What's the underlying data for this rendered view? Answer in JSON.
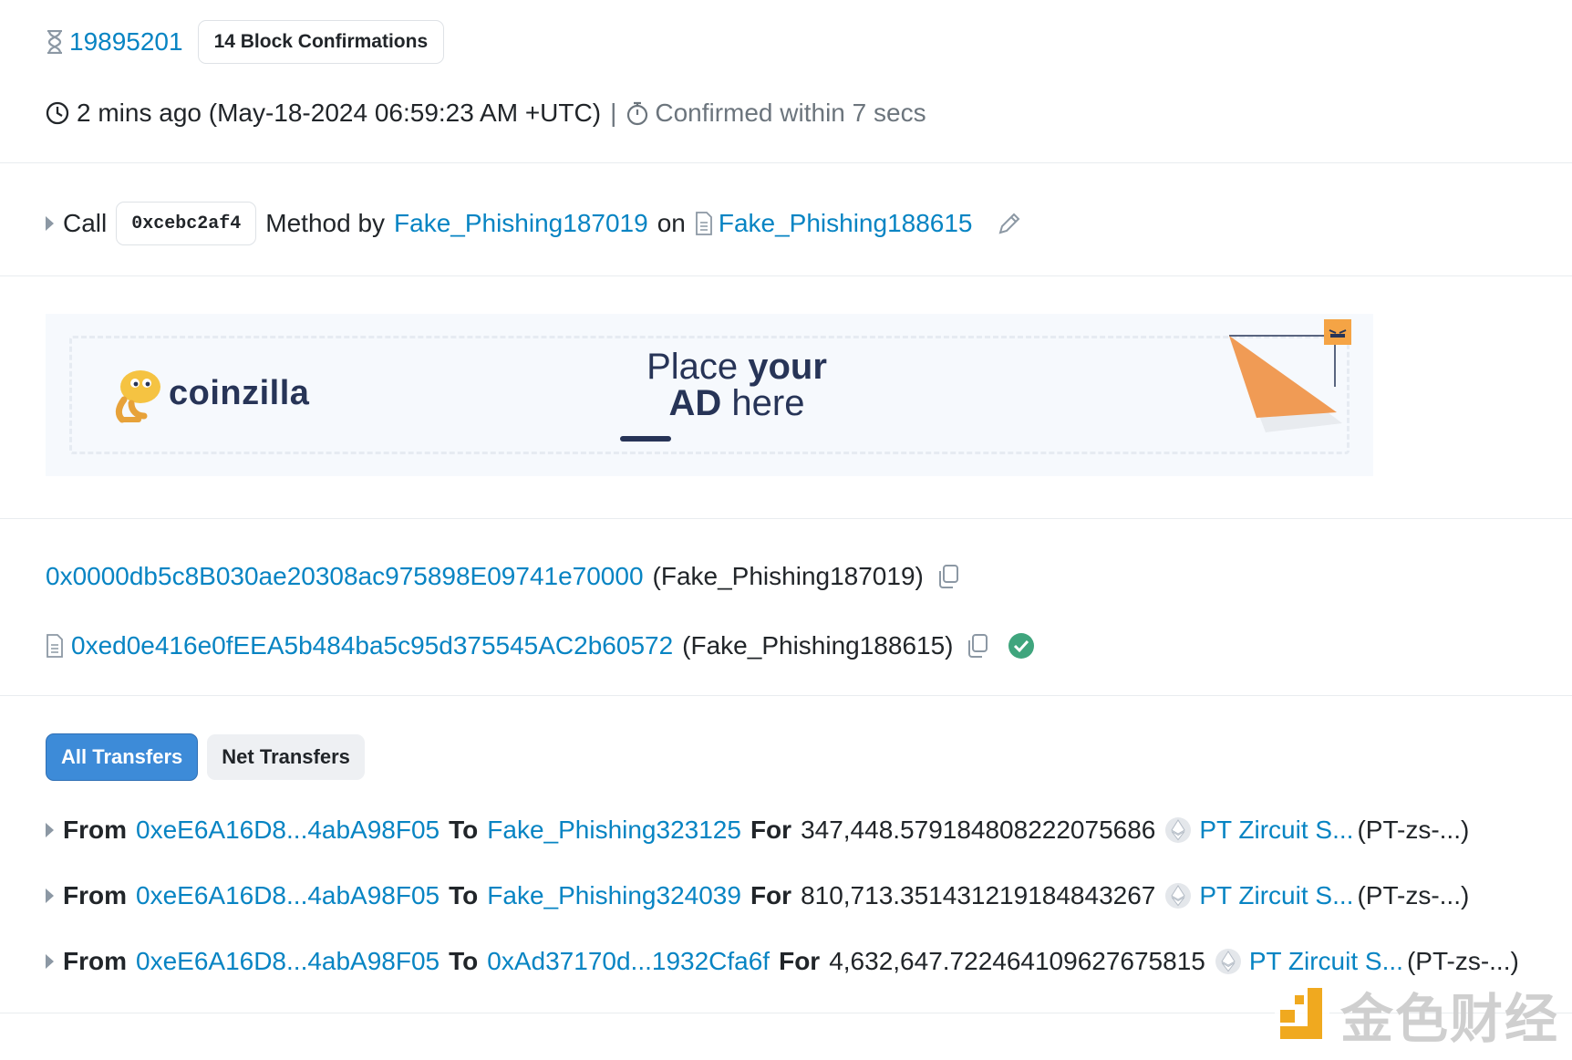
{
  "block": {
    "number": "19895201",
    "confirmations": "14 Block Confirmations"
  },
  "timestamp": {
    "ago": "2 mins ago (May-18-2024 06:59:23 AM +UTC)",
    "separator": "|",
    "confirmed": "Confirmed within 7 secs"
  },
  "action": {
    "call": "Call",
    "method_id": "0xcebc2af4",
    "method_by": "Method by",
    "caller": "Fake_Phishing187019",
    "on": "on",
    "contract": "Fake_Phishing188615"
  },
  "ad": {
    "brand": "coinzilla",
    "line1_a": "Place ",
    "line1_b": "your",
    "line2_a": "AD",
    "line2_b": " here"
  },
  "addresses": {
    "from": {
      "address": "0x0000db5c8B030ae20308ac975898E09741e70000",
      "label": "(Fake_Phishing187019)"
    },
    "to": {
      "address": "0xed0e416e0fEEA5b484ba5c95d375545AC2b60572",
      "label": "(Fake_Phishing188615)"
    }
  },
  "tabs": [
    {
      "label": "All Transfers",
      "active": true
    },
    {
      "label": "Net Transfers",
      "active": false
    }
  ],
  "transfers": [
    {
      "from_kw": "From",
      "from": "0xeE6A16D8...4abA98F05",
      "to_kw": "To",
      "to": "Fake_Phishing323125",
      "for_kw": "For",
      "amount": "347,448.579184808222075686",
      "token": "PT Zircuit S...",
      "symbol": "(PT-zs-...)"
    },
    {
      "from_kw": "From",
      "from": "0xeE6A16D8...4abA98F05",
      "to_kw": "To",
      "to": "Fake_Phishing324039",
      "for_kw": "For",
      "amount": "810,713.351431219184843267",
      "token": "PT Zircuit S...",
      "symbol": "(PT-zs-...)"
    },
    {
      "from_kw": "From",
      "from": "0xeE6A16D8...4abA98F05",
      "to_kw": "To",
      "to": "0xAd37170d...1932Cfa6f",
      "for_kw": "For",
      "amount": "4,632,647.722464109627675815",
      "token": "PT Zircuit S...",
      "symbol": "(PT-zs-...)"
    }
  ],
  "watermark": {
    "text": "金色财经"
  },
  "colors": {
    "link": "#0784c3",
    "tab_active": "#3d8bd8",
    "verified": "#3fa57d",
    "ad_orange": "#f09b55"
  }
}
